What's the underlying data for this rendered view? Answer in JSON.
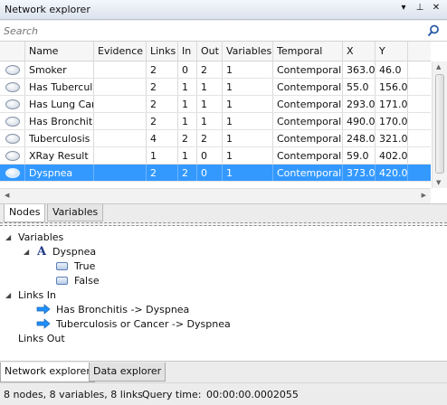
{
  "window": {
    "title": "Network explorer",
    "btn_dropdown": "▾",
    "btn_pin": "⊥",
    "btn_close": "✕"
  },
  "search": {
    "placeholder": "Search",
    "icon": "search-icon"
  },
  "grid": {
    "columns": [
      "",
      "Name",
      "Evidence",
      "Links",
      "In",
      "Out",
      "Variables",
      "Temporal",
      "X",
      "Y"
    ],
    "rows": [
      {
        "name": "Smoker",
        "evidence": "",
        "links": "2",
        "in": "0",
        "out": "2",
        "variables": "1",
        "temporal": "Contemporal",
        "x": "363.0",
        "y": "46.0",
        "selected": false
      },
      {
        "name": "Has Tuberculosis",
        "evidence": "",
        "links": "2",
        "in": "1",
        "out": "1",
        "variables": "1",
        "temporal": "Contemporal",
        "x": "55.0",
        "y": "156.0",
        "selected": false
      },
      {
        "name": "Has Lung Cancer",
        "evidence": "",
        "links": "2",
        "in": "1",
        "out": "1",
        "variables": "1",
        "temporal": "Contemporal",
        "x": "293.0",
        "y": "171.0",
        "selected": false
      },
      {
        "name": "Has Bronchitis",
        "evidence": "",
        "links": "2",
        "in": "1",
        "out": "1",
        "variables": "1",
        "temporal": "Contemporal",
        "x": "490.0",
        "y": "170.0",
        "selected": false
      },
      {
        "name": "Tuberculosis or Cancer",
        "evidence": "",
        "links": "4",
        "in": "2",
        "out": "2",
        "variables": "1",
        "temporal": "Contemporal",
        "x": "248.0",
        "y": "321.0",
        "selected": false
      },
      {
        "name": "XRay Result",
        "evidence": "",
        "links": "1",
        "in": "1",
        "out": "0",
        "variables": "1",
        "temporal": "Contemporal",
        "x": "59.0",
        "y": "402.0",
        "selected": false
      },
      {
        "name": "Dyspnea",
        "evidence": "",
        "links": "2",
        "in": "2",
        "out": "0",
        "variables": "1",
        "temporal": "Contemporal",
        "x": "373.0",
        "y": "420.0",
        "selected": true
      }
    ]
  },
  "subtabs": {
    "nodes": "Nodes",
    "variables": "Variables",
    "active": "Nodes"
  },
  "tree": {
    "variables_label": "Variables",
    "variable_name": "Dyspnea",
    "states": [
      "True",
      "False"
    ],
    "links_in_label": "Links In",
    "links_in": [
      "Has Bronchitis -> Dyspnea",
      "Tuberculosis or Cancer -> Dyspnea"
    ],
    "links_out_label": "Links Out"
  },
  "bottom_tabs": {
    "network_explorer": "Network explorer",
    "data_explorer": "Data explorer",
    "active": "Network explorer"
  },
  "status": {
    "summary": "8 nodes, 8 variables, 8 links",
    "query_label": "Query time:",
    "query_time": "00:00:00.0002055"
  },
  "colors": {
    "selection": "#3399ff",
    "link_arrow": "#1e90ff"
  }
}
